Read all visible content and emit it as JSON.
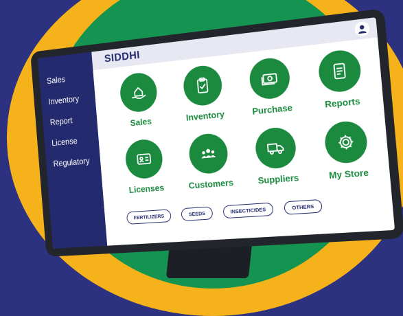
{
  "app": {
    "brand": "SIDDHI"
  },
  "header": {
    "user_icon": "user-icon"
  },
  "sidebar": {
    "items": [
      {
        "label": "Sales"
      },
      {
        "label": "Inventory"
      },
      {
        "label": "Report"
      },
      {
        "label": "License"
      },
      {
        "label": "Regulatory"
      }
    ]
  },
  "tiles": [
    {
      "label": "Sales",
      "icon": "house-in-hand-icon"
    },
    {
      "label": "Inventory",
      "icon": "clipboard-check-icon"
    },
    {
      "label": "Purchase",
      "icon": "cash-icon"
    },
    {
      "label": "Reports",
      "icon": "document-icon"
    },
    {
      "label": "Licenses",
      "icon": "id-card-icon"
    },
    {
      "label": "Customers",
      "icon": "people-icon"
    },
    {
      "label": "Suppliers",
      "icon": "truck-icon"
    },
    {
      "label": "My Store",
      "icon": "gear-icon"
    }
  ],
  "chips": [
    {
      "label": "FERTILIZERS"
    },
    {
      "label": "SEEDS"
    },
    {
      "label": "INSECTICIDES"
    },
    {
      "label": "OTHERS"
    }
  ],
  "colors": {
    "background": "#2d3280",
    "yellow": "#f6b21b",
    "green": "#149450",
    "tile_green": "#1b8a3f",
    "sidebar": "#232a6e"
  }
}
